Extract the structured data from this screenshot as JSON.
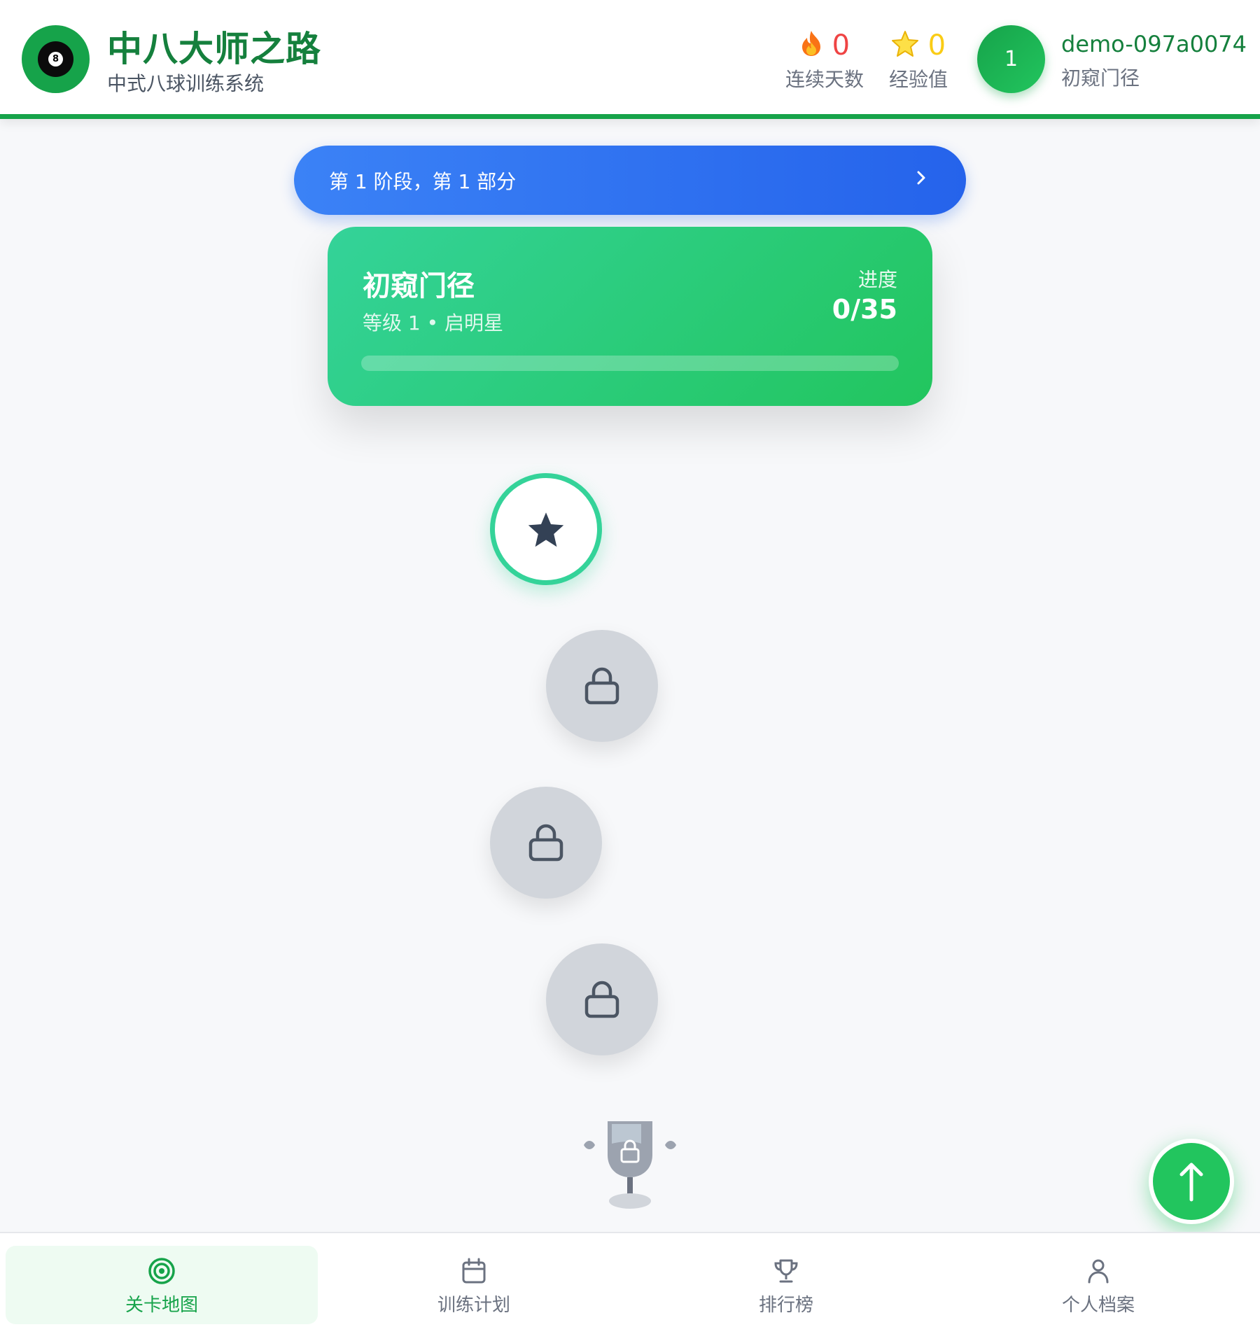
{
  "header": {
    "logo_ball_number": "8",
    "title": "中八大师之路",
    "subtitle": "中式八球训练系统",
    "streak": {
      "icon": "fire-icon",
      "value": "0",
      "label": "连续天数"
    },
    "xp": {
      "icon": "star-icon",
      "value": "0",
      "label": "经验值"
    },
    "user": {
      "avatar_text": "1",
      "name": "demo-097a0074",
      "rank": "初窥门径"
    }
  },
  "section_banner": {
    "text": "第 1 阶段，第 1 部分",
    "icon": "chevron-right-icon"
  },
  "level_card": {
    "name": "初窥门径",
    "subtitle": "等级 1 • 启明星",
    "progress_label": "进度",
    "progress_value": "0/35",
    "progress_fraction": 0
  },
  "map_nodes": [
    {
      "state": "current",
      "icon": "star-icon"
    },
    {
      "state": "locked",
      "icon": "lock-icon"
    },
    {
      "state": "locked",
      "icon": "lock-icon"
    },
    {
      "state": "locked",
      "icon": "lock-icon"
    }
  ],
  "reward": {
    "state": "locked",
    "icon": "trophy-icon"
  },
  "fab": {
    "icon": "arrow-up-icon"
  },
  "bottom_nav": [
    {
      "label": "关卡地图",
      "icon": "target-icon",
      "active": true
    },
    {
      "label": "训练计划",
      "icon": "calendar-icon",
      "active": false
    },
    {
      "label": "排行榜",
      "icon": "trophy-icon",
      "active": false
    },
    {
      "label": "个人档案",
      "icon": "user-icon",
      "active": false
    }
  ],
  "colors": {
    "brand_green": "#16a34a",
    "banner_blue": "#2563eb",
    "card_green": "#22c55e",
    "locked_gray": "#d1d5db"
  }
}
